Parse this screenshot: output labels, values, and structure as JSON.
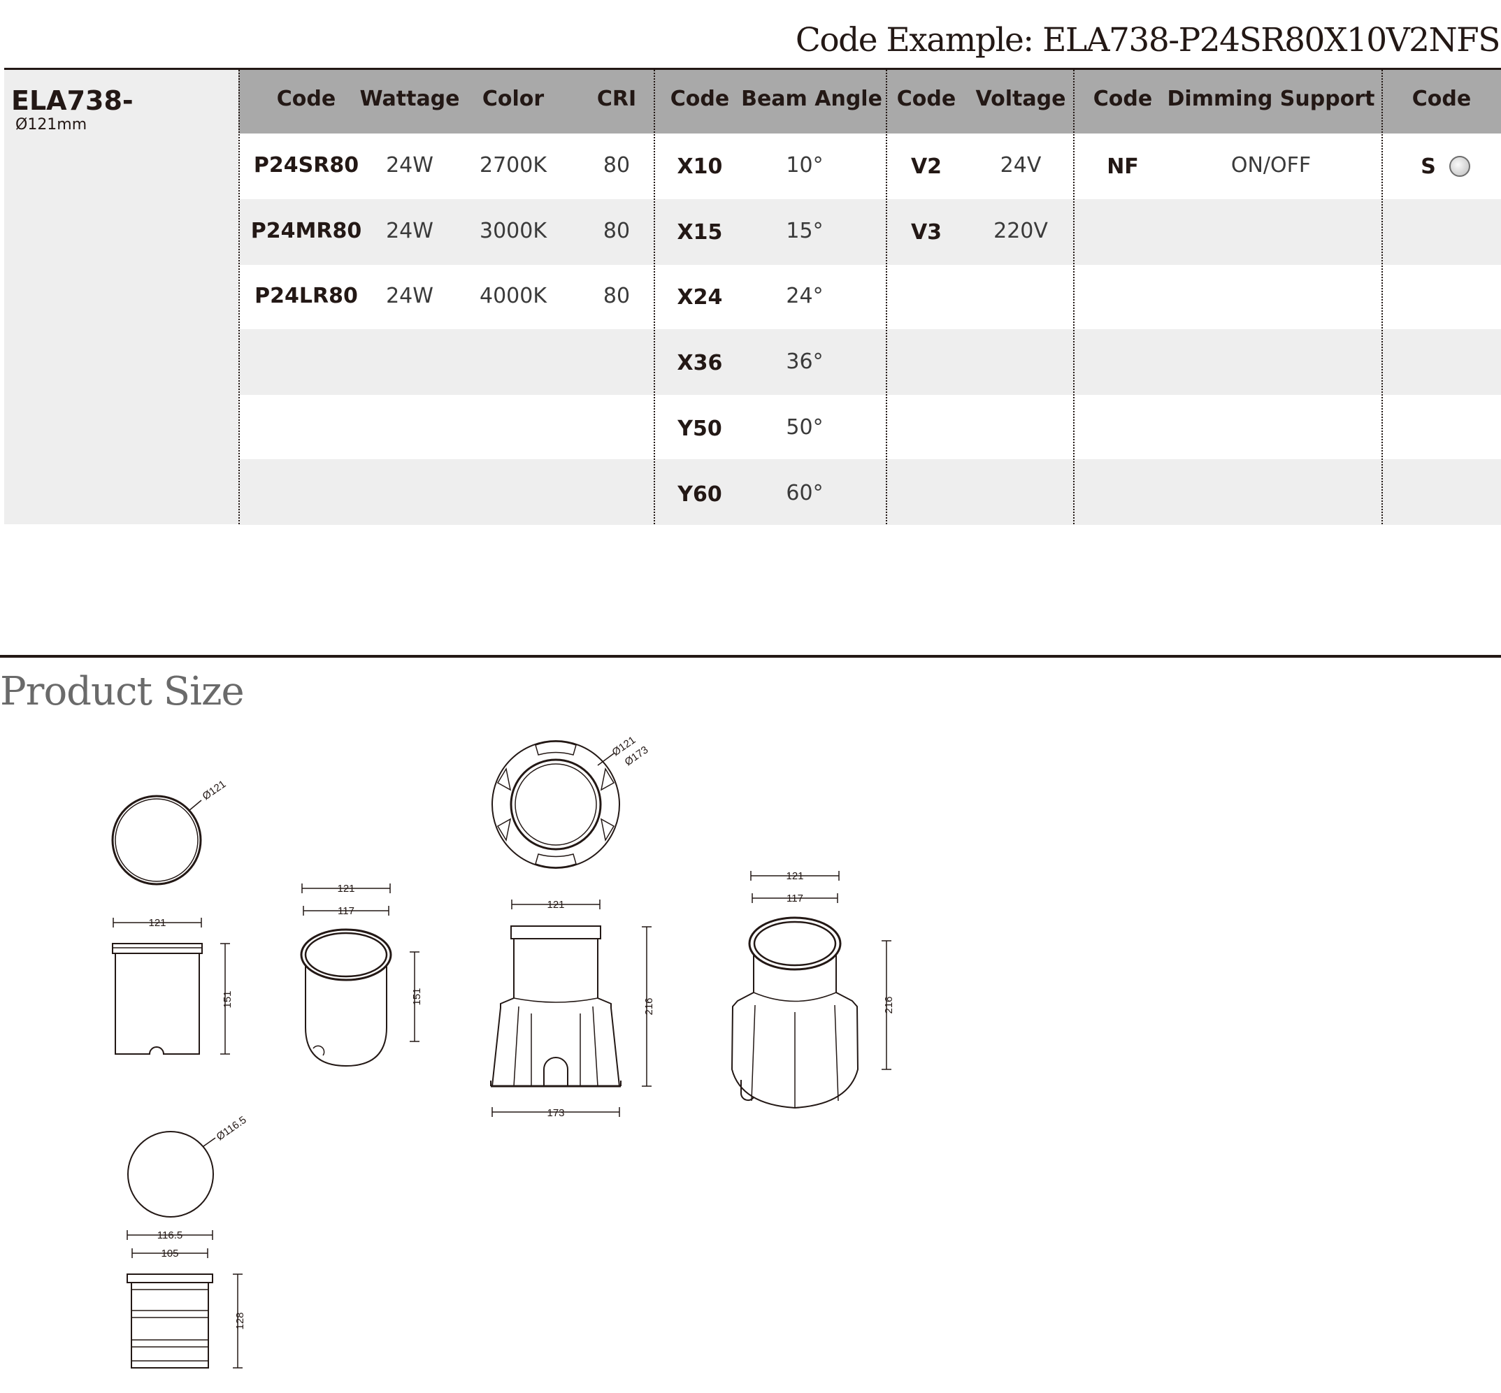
{
  "code_example": "Code Example: ELA738-P24SR80X10V2NFS",
  "product": {
    "name": "ELA738-",
    "diameter": "Ø121mm"
  },
  "headers": {
    "code1": "Code",
    "wattage": "Wattage",
    "color": "Color",
    "cri": "CRI",
    "code2": "Code",
    "beam_angle": "Beam Angle",
    "code3": "Code",
    "voltage": "Voltage",
    "code4": "Code",
    "dimming": "Dimming Support",
    "code5": "Code"
  },
  "light_rows": [
    {
      "code": "P24SR80",
      "wattage": "24W",
      "color": "2700K",
      "cri": "80"
    },
    {
      "code": "P24MR80",
      "wattage": "24W",
      "color": "3000K",
      "cri": "80"
    },
    {
      "code": "P24LR80",
      "wattage": "24W",
      "color": "4000K",
      "cri": "80"
    }
  ],
  "beam_rows": [
    {
      "code": "X10",
      "angle": "10°"
    },
    {
      "code": "X15",
      "angle": "15°"
    },
    {
      "code": "X24",
      "angle": "24°"
    },
    {
      "code": "X36",
      "angle": "36°"
    },
    {
      "code": "Y50",
      "angle": "50°"
    },
    {
      "code": "Y60",
      "angle": "60°"
    }
  ],
  "voltage_rows": [
    {
      "code": "V2",
      "voltage": "24V"
    },
    {
      "code": "V3",
      "voltage": "220V"
    }
  ],
  "dimming_rows": [
    {
      "code": "NF",
      "support": "ON/OFF"
    }
  ],
  "finish_rows": [
    {
      "code": "S",
      "swatch_color": "#c8c8c8"
    }
  ],
  "section_title": "Product Size",
  "dimensions": {
    "d121a": "Ø121",
    "w121a": "121",
    "h151a": "151",
    "w121b": "121",
    "w117b": "117",
    "h151b": "151",
    "d121c": "Ø121",
    "d173c": "Ø173",
    "w121c": "121",
    "h216c": "216",
    "w173c": "173",
    "w121d": "121",
    "w117d": "117",
    "h216d": "216",
    "d1165": "Ø116.5",
    "w1165": "116.5",
    "w105": "105",
    "h128": "128"
  },
  "colors": {
    "header_bg": "#a9a9a9",
    "row_shade": "#eeeeee",
    "text": "#231815"
  }
}
